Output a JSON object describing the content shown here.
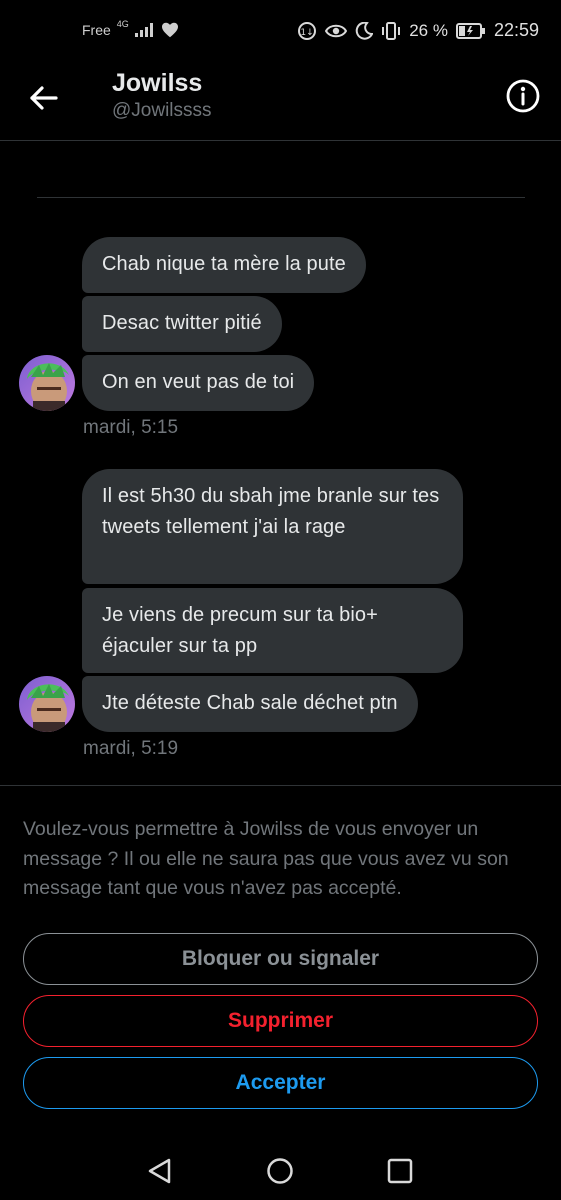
{
  "status_bar": {
    "carrier": "Free",
    "network": "4G",
    "battery": "26 %",
    "time": "22:59"
  },
  "header": {
    "name": "Jowilss",
    "handle": "@Jowilssss"
  },
  "messages": {
    "group1": [
      "Chab nique ta mère la pute",
      "Desac twitter pitié",
      "On en veut pas de toi"
    ],
    "group1_time": "mardi, 5:15",
    "group2": [
      "Il est 5h30 du sbah jme branle sur tes tweets tellement j'ai la rage",
      "Je viens de precum sur ta bio+ éjaculer sur ta pp",
      "Jte déteste Chab sale déchet ptn"
    ],
    "group2_time": "mardi, 5:19"
  },
  "request": {
    "text": "Voulez-vous permettre à Jowilss de vous envoyer un message ? Il ou elle ne saura pas que vous avez vu son message tant que vous n'avez pas accepté.",
    "block_label": "Bloquer ou signaler",
    "delete_label": "Supprimer",
    "accept_label": "Accepter"
  },
  "icons": {
    "back": "arrow-left-icon",
    "info": "info-icon",
    "avatar": "avatar-image",
    "nav_back": "triangle-back-icon",
    "nav_home": "circle-home-icon",
    "nav_recents": "square-recents-icon"
  },
  "colors": {
    "background": "#000000",
    "bubble": "#2f3336",
    "muted_text": "#71767b",
    "delete": "#f4212e",
    "accept": "#1d9bf0"
  }
}
